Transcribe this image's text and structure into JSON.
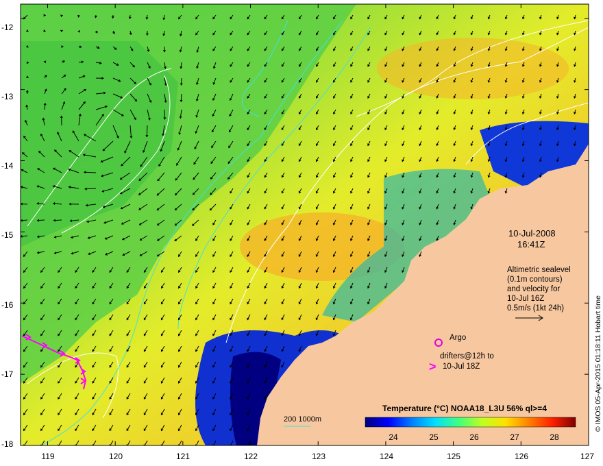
{
  "map": {
    "lon_ticks": [
      "119",
      "120",
      "121",
      "122",
      "123",
      "124",
      "125",
      "126",
      "127"
    ],
    "lat_ticks": [
      "-12",
      "-13",
      "-14",
      "-15",
      "-16",
      "-17",
      "-18"
    ],
    "lon_range": [
      118.6,
      127.0
    ],
    "lat_range": [
      -18.0,
      -11.8
    ]
  },
  "annotations": {
    "date": "10-Jul-2008",
    "time": "16:41Z",
    "desc_lines": [
      "Altimetric sealevel",
      "(0.1m contours)",
      "and velocity for",
      "10-Jul 16Z",
      "0.5m/s (1kt 24h)"
    ],
    "argo_label": "Argo",
    "drifters_line1": "drifters@12h to",
    "drifters_line2": "10-Jul 18Z",
    "drifter_symbol": ">",
    "bathy_label": "200  1000m",
    "credit": "© IMOS 05-Apr-2015 01:18:11 Hobart time"
  },
  "colorbar": {
    "title": "Temperature (°C) NOAA18_L3U 56% ql>=4",
    "ticks": [
      "24",
      "25",
      "26",
      "27",
      "28"
    ],
    "colors": [
      "#00007f",
      "#0000ff",
      "#0080ff",
      "#00e0ff",
      "#40ff80",
      "#c0ff20",
      "#ffe000",
      "#ff8000",
      "#ff2000",
      "#800000"
    ]
  },
  "colors": {
    "land": "#f7c8a0",
    "argo": "#e000e0",
    "drifter": "#ff00ff",
    "contour": "#ffffff",
    "bathy": "#40e0e0"
  }
}
